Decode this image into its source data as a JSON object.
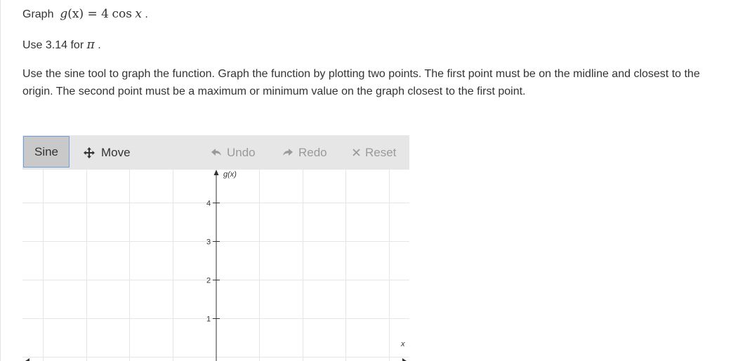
{
  "question": {
    "graph_word": "Graph",
    "func_lhs": "g",
    "func_var": "(x)",
    "func_eq": " = 4",
    "func_cos": "cos",
    "func_x": "x",
    "period": "."
  },
  "pi_line": {
    "prefix": "Use 3.14 for",
    "pi": "π",
    "suffix": "."
  },
  "instructions": "Use the sine tool to graph the function. Graph the function by plotting two points. The first point must be on the midline and closest to the origin. The second point must be a maximum or minimum value on the graph closest to the first point.",
  "toolbar": {
    "sine_label": "Sine",
    "move_label": "Move",
    "undo_label": "Undo",
    "redo_label": "Redo",
    "reset_label": "Reset"
  },
  "graph": {
    "y_axis_label": "g(x)",
    "x_axis_label": "x",
    "y_ticks": [
      "4",
      "3",
      "2",
      "1"
    ]
  },
  "colors": {
    "toolbar_bg": "#e6e6e6",
    "sine_active_bg": "#c9c9c9",
    "sine_active_border": "#6fa0d8",
    "grid_line": "#e5e5e5",
    "axis": "#333333"
  }
}
